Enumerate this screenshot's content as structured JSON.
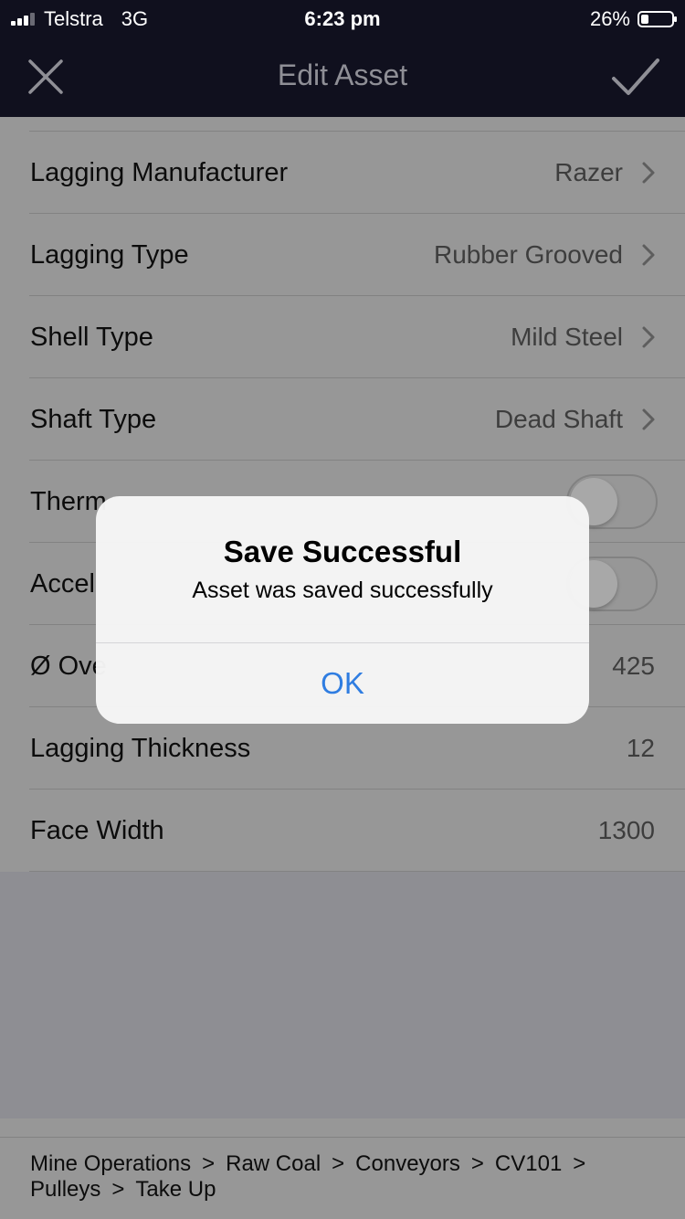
{
  "status_bar": {
    "carrier": "Telstra",
    "network": "3G",
    "time": "6:23 pm",
    "battery": "26%",
    "battery_level": 0.26
  },
  "nav": {
    "title": "Edit Asset",
    "close_icon": "close-icon",
    "save_icon": "checkmark-icon"
  },
  "rows": [
    {
      "label": "Lagging Manufacturer",
      "value": "Razer"
    },
    {
      "label": "Lagging Type",
      "value": "Rubber Grooved"
    },
    {
      "label": "Shell Type",
      "value": "Mild Steel"
    },
    {
      "label": "Shaft Type",
      "value": "Dead Shaft"
    },
    {
      "label": "Therm",
      "toggle": false
    },
    {
      "label": "Accel",
      "toggle": false
    },
    {
      "label": "Ø Ove",
      "value": "425"
    },
    {
      "label": "Lagging Thickness",
      "value": "12"
    },
    {
      "label": "Face Width",
      "value": "1300"
    }
  ],
  "breadcrumb": [
    "Mine Operations",
    "Raw Coal",
    "Conveyors",
    "CV101",
    "Pulleys",
    "Take Up"
  ],
  "breadcrumb_separator": ">",
  "alert": {
    "title": "Save Successful",
    "message": "Asset was saved successfully",
    "ok_label": "OK"
  },
  "colors": {
    "nav_background": "#10101e",
    "list_background": "#979797",
    "alert_background": "#f6f6f6",
    "accent": "#2f7de1"
  }
}
